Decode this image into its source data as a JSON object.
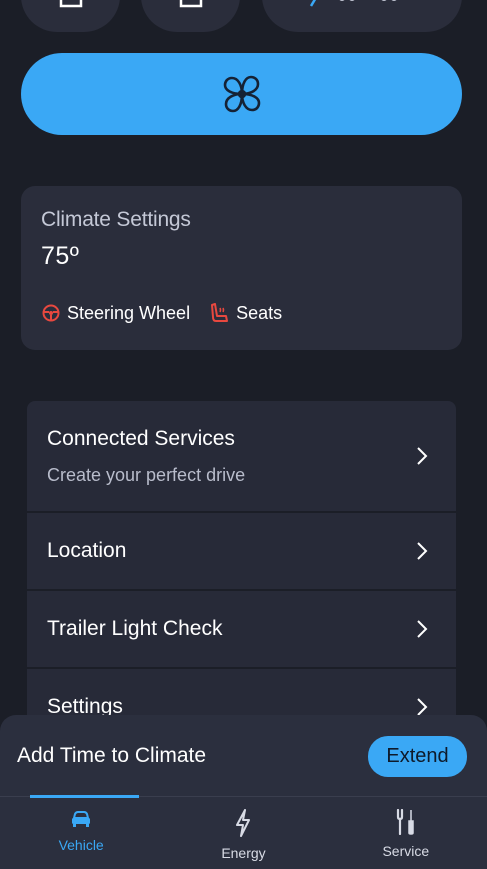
{
  "fan_button": {
    "icon": "fan-icon"
  },
  "climate": {
    "title": "Climate Settings",
    "temperature": "75º",
    "features": [
      {
        "icon": "steering-wheel-heat-icon",
        "label": "Steering Wheel"
      },
      {
        "icon": "seat-heat-icon",
        "label": "Seats"
      }
    ]
  },
  "menu": {
    "connected_services": {
      "label": "Connected Services",
      "subtitle": "Create your perfect drive"
    },
    "location": {
      "label": "Location"
    },
    "trailer_light_check": {
      "label": "Trailer Light Check"
    },
    "settings": {
      "label": "Settings"
    }
  },
  "toast": {
    "text": "Add Time to Climate",
    "button": "Extend"
  },
  "bottom_nav": {
    "items": [
      {
        "label": "Vehicle",
        "icon": "car-icon",
        "active": true
      },
      {
        "label": "Energy",
        "icon": "lightning-icon",
        "active": false
      },
      {
        "label": "Service",
        "icon": "wrench-screwdriver-icon",
        "active": false
      }
    ]
  },
  "colors": {
    "background": "#1b1e27",
    "card": "#2a2d3b",
    "accent": "#3aa8f5",
    "heat_icon": "#e8483f"
  }
}
